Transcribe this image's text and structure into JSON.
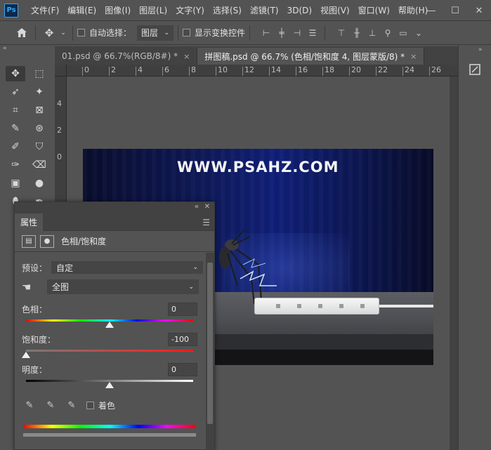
{
  "menu": {
    "logo": "Ps",
    "items": [
      "文件(F)",
      "编辑(E)",
      "图像(I)",
      "图层(L)",
      "文字(Y)",
      "选择(S)",
      "滤镜(T)",
      "3D(D)",
      "视图(V)",
      "窗口(W)",
      "帮助(H)"
    ],
    "window_controls": [
      "—",
      "☐",
      "✕"
    ]
  },
  "options": {
    "auto_select_label": "自动选择：",
    "auto_select_target": "图层",
    "show_transform_label": "显示变换控件"
  },
  "tabs": [
    {
      "label": "01.psd @ 66.7%(RGB/8#) *",
      "close": "×"
    },
    {
      "label": "拼图稿.psd @ 66.7% (色相/饱和度 4, 图层蒙版/8) *",
      "close": "×"
    }
  ],
  "ruler": {
    "h_ticks": [
      "0",
      "2",
      "4",
      "6",
      "8",
      "10",
      "12",
      "14",
      "16",
      "18",
      "20",
      "22",
      "24",
      "26"
    ],
    "v_ticks": [
      "4",
      "2",
      "0"
    ]
  },
  "canvas": {
    "watermark": "WWW.PSAHZ.COM"
  },
  "properties": {
    "tab_label": "属性",
    "panel_title": "色相/饱和度",
    "preset_label": "预设：",
    "preset_value": "自定",
    "channel_value": "全图",
    "hue_label": "色相：",
    "hue_value": "0",
    "hue_level": 0.5,
    "saturation_label": "饱和度：",
    "saturation_value": "-100",
    "saturation_level": 0.0,
    "lightness_label": "明度：",
    "lightness_value": "0",
    "lightness_level": 0.5,
    "colorize_label": "着色"
  },
  "colors": {
    "ui_bg": "#535353",
    "panel_dark": "#424242",
    "doc_blue": "#10207a"
  }
}
